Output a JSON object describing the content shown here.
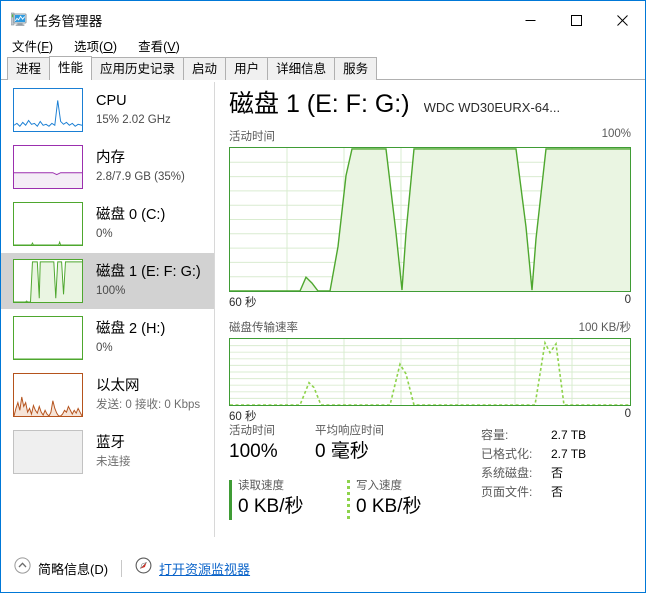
{
  "window": {
    "title": "任务管理器",
    "icon": "task-manager-icon",
    "minimize": "—",
    "maximize": "□",
    "close": "✕"
  },
  "menu": [
    {
      "label": "文件",
      "mnemonic": "F"
    },
    {
      "label": "选项",
      "mnemonic": "O"
    },
    {
      "label": "查看",
      "mnemonic": "V"
    }
  ],
  "tabs": [
    {
      "label": "进程",
      "active": false
    },
    {
      "label": "性能",
      "active": true
    },
    {
      "label": "应用历史记录",
      "active": false
    },
    {
      "label": "启动",
      "active": false
    },
    {
      "label": "用户",
      "active": false
    },
    {
      "label": "详细信息",
      "active": false
    },
    {
      "label": "服务",
      "active": false
    }
  ],
  "sidebar": {
    "items": [
      {
        "name": "cpu",
        "title": "CPU",
        "sub": "15% 2.02 GHz",
        "color": "#1a7fd4",
        "selected": false
      },
      {
        "name": "memory",
        "title": "内存",
        "sub": "2.8/7.9 GB (35%)",
        "color": "#9b2fae",
        "selected": false
      },
      {
        "name": "disk-0",
        "title": "磁盘 0 (C:)",
        "sub": "0%",
        "color": "#4ea72e",
        "selected": false
      },
      {
        "name": "disk-1",
        "title": "磁盘 1 (E: F: G:)",
        "sub": "100%",
        "color": "#4ea72e",
        "selected": true
      },
      {
        "name": "disk-2",
        "title": "磁盘 2 (H:)",
        "sub": "0%",
        "color": "#4ea72e",
        "selected": false
      },
      {
        "name": "ethernet",
        "title": "以太网",
        "sub": "发送: 0 接收: 0 Kbps",
        "color": "#b5531d",
        "selected": false
      },
      {
        "name": "bluetooth",
        "title": "蓝牙",
        "sub": "未连接",
        "color": "#8a8a8a",
        "selected": false
      }
    ]
  },
  "main": {
    "title": "磁盘 1 (E: F: G:)",
    "device": "WDC WD30EURX-64...",
    "activity_chart": {
      "caption": "活动时间",
      "max_label": "100%",
      "left_label": "60 秒",
      "right_label": "0"
    },
    "transfer_chart": {
      "caption": "磁盘传输速率",
      "max_label": "100 KB/秒",
      "left_label": "60 秒",
      "right_label": "0"
    },
    "stats": {
      "active_time_label": "活动时间",
      "active_time_value": "100%",
      "avg_response_label": "平均响应时间",
      "avg_response_value": "0 毫秒",
      "read_label": "读取速度",
      "read_value": "0 KB/秒",
      "write_label": "写入速度",
      "write_value": "0 KB/秒"
    },
    "info": [
      {
        "key": "容量:",
        "value": "2.7 TB"
      },
      {
        "key": "已格式化:",
        "value": "2.7 TB"
      },
      {
        "key": "系统磁盘:",
        "value": "否"
      },
      {
        "key": "页面文件:",
        "value": "否"
      }
    ]
  },
  "statusbar": {
    "fewer_details": "简略信息(D)",
    "collapse_icon": "chevron-up-circle-icon",
    "resmon_icon": "resource-monitor-icon",
    "resmon_link": "打开资源监视器"
  },
  "chart_data": {
    "type": "area",
    "title": "磁盘 1 (E: F: G:) 活动时间",
    "xlabel": "60 秒",
    "ylabel": "活动时间",
    "ylim": [
      0,
      100
    ],
    "grid": true,
    "series": [
      {
        "name": "活动时间",
        "unit": "%",
        "color": "#4ea72e",
        "fill": "#eaf5e2",
        "values": [
          0,
          0,
          0,
          0,
          0,
          0,
          0,
          0,
          0,
          0,
          0,
          0,
          0,
          0,
          0,
          0,
          0,
          0,
          0,
          0,
          0,
          0,
          0,
          0,
          0,
          0,
          0,
          0,
          0,
          0,
          0,
          0,
          0,
          0,
          0,
          0,
          0,
          0,
          0,
          0,
          0,
          0,
          0,
          0,
          0,
          0,
          0,
          0,
          0,
          0,
          3,
          7,
          9,
          8,
          6,
          3,
          0,
          0,
          0,
          0,
          0,
          0,
          0,
          0,
          0,
          0,
          0,
          0,
          0,
          0,
          0,
          0,
          0,
          0,
          0,
          0,
          0,
          0,
          0,
          0,
          0,
          0,
          0,
          0,
          12,
          46,
          80,
          100,
          100,
          100,
          100,
          100,
          100,
          100,
          100,
          100,
          100,
          100,
          100,
          100,
          100,
          100,
          100,
          100,
          100,
          100,
          100,
          100,
          100,
          100,
          98,
          80,
          55,
          28,
          4,
          0,
          22,
          58,
          86,
          100,
          100,
          100,
          100,
          100,
          100,
          100,
          100,
          100,
          100,
          100,
          100,
          100,
          100,
          100,
          100,
          100,
          100,
          100,
          100,
          100,
          100,
          100,
          100,
          100,
          100,
          100,
          100,
          100,
          100,
          100,
          100,
          100,
          100,
          100,
          100,
          100,
          100,
          100,
          100,
          100,
          100,
          100,
          100,
          100,
          100,
          100,
          100,
          100,
          100,
          100,
          100,
          100,
          100,
          100,
          100,
          100,
          100,
          100,
          100,
          100,
          100,
          100,
          100,
          100,
          100,
          100,
          100,
          100,
          100,
          100,
          100,
          100,
          100,
          100,
          100,
          100,
          100,
          100,
          100,
          96,
          72,
          42,
          14,
          0,
          0,
          0,
          0,
          0,
          0,
          0,
          0,
          8,
          44,
          78,
          100,
          100,
          100,
          100,
          100,
          100,
          100,
          100,
          100,
          100,
          100,
          100,
          100,
          100,
          100,
          100,
          100,
          100,
          100,
          100,
          100,
          100,
          100,
          100,
          100,
          100,
          100,
          100,
          100,
          100,
          100,
          100,
          100,
          100,
          100,
          100,
          100,
          100,
          100,
          100,
          100,
          100,
          100,
          100,
          100
        ]
      }
    ],
    "secondary_chart": {
      "type": "line",
      "title": "磁盘传输速率",
      "ylabel": "KB/秒",
      "ylim": [
        0,
        100
      ],
      "xlabel": "60 秒",
      "series": [
        {
          "name": "读取速度",
          "style": "solid",
          "color": "#3f9c35",
          "values": [
            0,
            0,
            0,
            0,
            0,
            0,
            0,
            0,
            0,
            0,
            0,
            0,
            0,
            0,
            0,
            0,
            0,
            0,
            0,
            0,
            0,
            0,
            0,
            0,
            0,
            0,
            0,
            0,
            0,
            0,
            0,
            0,
            0,
            0,
            0,
            0,
            0,
            0,
            0,
            0,
            0,
            0,
            0,
            0,
            0,
            0,
            0,
            0,
            0,
            0,
            0,
            0,
            0,
            0,
            0,
            0,
            0,
            0,
            0,
            0
          ]
        },
        {
          "name": "写入速度",
          "style": "dashed",
          "color": "#8ed34b",
          "values": [
            0,
            0,
            0,
            0,
            0,
            0,
            0,
            0,
            0,
            0,
            0,
            0,
            0,
            8,
            22,
            38,
            30,
            16,
            4,
            0,
            0,
            0,
            0,
            0,
            0,
            0,
            0,
            0,
            0,
            0,
            0,
            16,
            40,
            62,
            48,
            26,
            6,
            0,
            0,
            0,
            0,
            0,
            0,
            0,
            0,
            0,
            0,
            0,
            28,
            62,
            88,
            95,
            70,
            40,
            12,
            0,
            0,
            0,
            0,
            0
          ]
        }
      ]
    }
  }
}
